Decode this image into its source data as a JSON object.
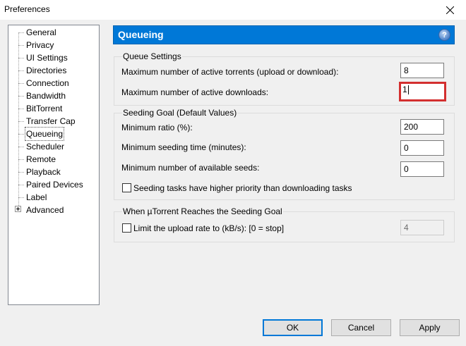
{
  "window": {
    "title": "Preferences"
  },
  "sidebar": {
    "items": [
      {
        "label": "General"
      },
      {
        "label": "Privacy"
      },
      {
        "label": "UI Settings"
      },
      {
        "label": "Directories"
      },
      {
        "label": "Connection"
      },
      {
        "label": "Bandwidth"
      },
      {
        "label": "BitTorrent"
      },
      {
        "label": "Transfer Cap"
      },
      {
        "label": "Queueing",
        "selected": true
      },
      {
        "label": "Scheduler"
      },
      {
        "label": "Remote"
      },
      {
        "label": "Playback"
      },
      {
        "label": "Paired Devices"
      },
      {
        "label": "Label"
      },
      {
        "label": "Advanced",
        "expandable": true
      }
    ]
  },
  "header": {
    "title": "Queueing",
    "help_icon": "question-icon",
    "help_glyph": "?"
  },
  "queue": {
    "title": "Queue Settings",
    "max_active_torrents_label": "Maximum number of active torrents (upload or download):",
    "max_active_torrents_value": "8",
    "max_active_downloads_label": "Maximum number of active downloads:",
    "max_active_downloads_value": "1"
  },
  "seeding": {
    "title": "Seeding Goal (Default Values)",
    "min_ratio_label": "Minimum ratio (%):",
    "min_ratio_value": "200",
    "min_time_label": "Minimum seeding time (minutes):",
    "min_time_value": "0",
    "min_seeds_label": "Minimum number of available seeds:",
    "min_seeds_value": "0",
    "priority_label": "Seeding tasks have higher priority than downloading tasks",
    "priority_checked": false
  },
  "goal": {
    "title": "When µTorrent Reaches the Seeding Goal",
    "limit_label": "Limit the upload rate to (kB/s): [0 = stop]",
    "limit_checked": false,
    "limit_value": "4"
  },
  "buttons": {
    "ok": "OK",
    "cancel": "Cancel",
    "apply": "Apply"
  },
  "colors": {
    "accent": "#0078d7",
    "highlight_box": "#d32f2f"
  }
}
